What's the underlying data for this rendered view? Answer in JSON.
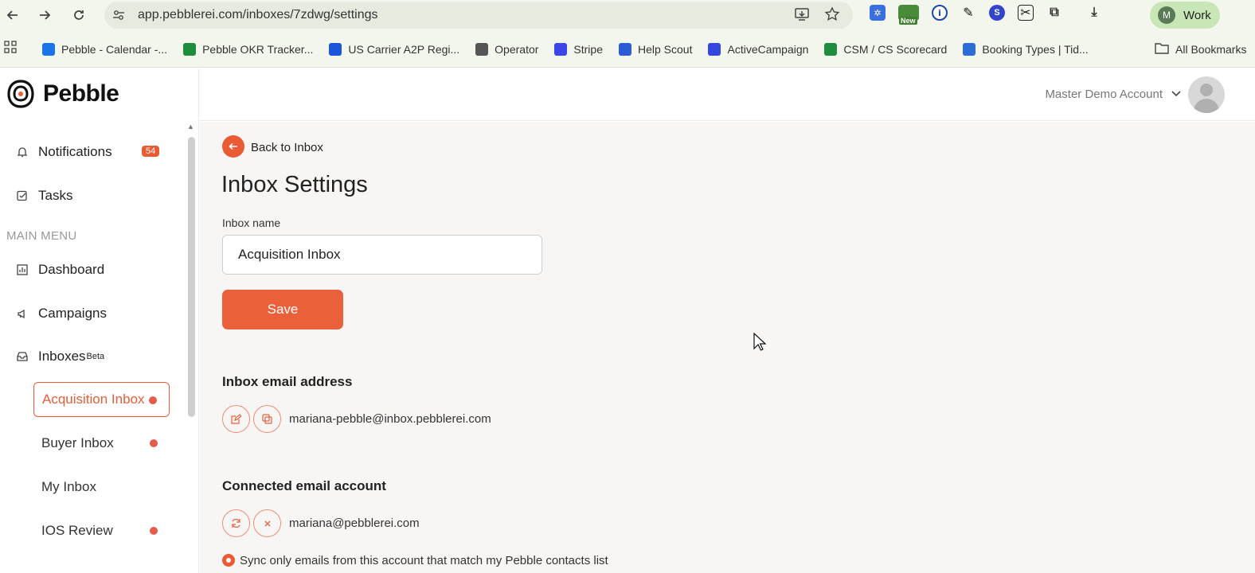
{
  "browser": {
    "url": "app.pebblerei.com/inboxes/7zdwg/settings",
    "profile_initial": "M",
    "profile_name": "Work",
    "ext_new_label": "New",
    "bookmarks": [
      {
        "label": "Pebble - Calendar -...",
        "color": "#1a73e8"
      },
      {
        "label": "Pebble OKR Tracker...",
        "color": "#1e8e3e"
      },
      {
        "label": "US Carrier A2P Regi...",
        "color": "#1a56db"
      },
      {
        "label": "Operator",
        "color": "#555555"
      },
      {
        "label": "Stripe",
        "color": "#3b46e6"
      },
      {
        "label": "Help Scout",
        "color": "#2b5bd7"
      },
      {
        "label": "ActiveCampaign",
        "color": "#3547e0"
      },
      {
        "label": "CSM / CS Scorecard",
        "color": "#1e8e3e"
      },
      {
        "label": "Booking Types | Tid...",
        "color": "#2c6cd6"
      }
    ],
    "all_bookmarks": "All Bookmarks"
  },
  "app": {
    "logo_text": "Pebble",
    "accent": "#e9603a",
    "sidebar": {
      "notifications_label": "Notifications",
      "notifications_count": "54",
      "tasks_label": "Tasks",
      "main_menu_label": "MAIN MENU",
      "dashboard_label": "Dashboard",
      "campaigns_label": "Campaigns",
      "inboxes_label": "Inboxes",
      "inboxes_sup": "Beta",
      "inboxes": [
        {
          "label": "Acquisition Inbox",
          "active": true,
          "dot": true
        },
        {
          "label": "Buyer Inbox",
          "active": false,
          "dot": true
        },
        {
          "label": "My Inbox",
          "active": false,
          "dot": false
        },
        {
          "label": "IOS Review",
          "active": false,
          "dot": true
        }
      ]
    },
    "header": {
      "account_name": "Master Demo Account"
    },
    "main": {
      "back_label": "Back to Inbox",
      "title": "Inbox Settings",
      "inbox_name_label": "Inbox name",
      "inbox_name_value": "Acquisition Inbox",
      "save_label": "Save",
      "inbox_email_title": "Inbox email address",
      "inbox_email": "mariana-pebble@inbox.pebblerei.com",
      "connected_title": "Connected email account",
      "connected_email": "mariana@pebblerei.com",
      "sync_option_label": "Sync only emails from this account that match my Pebble contacts list"
    }
  }
}
